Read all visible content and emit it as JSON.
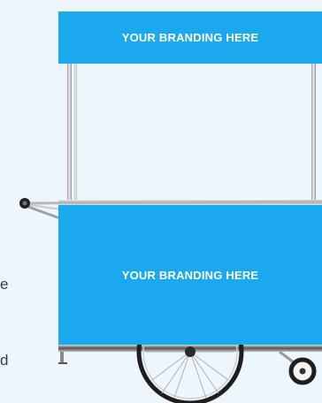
{
  "cart": {
    "top_banner_text": "YOUR BRANDING HERE",
    "bottom_banner_text": "YOUR BRANDING HERE",
    "banner_color": "#1aa9ee"
  },
  "side_text": {
    "line1": "e",
    "line2": "d"
  }
}
